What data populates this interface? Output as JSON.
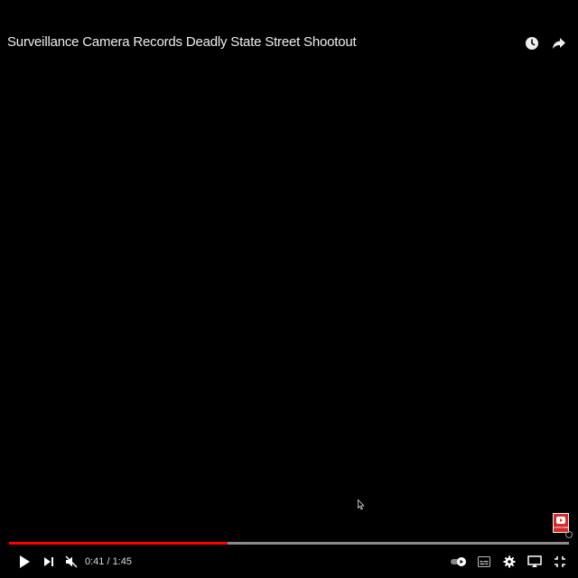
{
  "video": {
    "title": "Surveillance Camera Records Deadly State Street Shootout",
    "current_time": "0:41",
    "duration": "1:45",
    "time_display": "0:41 / 1:45",
    "progress_fraction": 0.39
  },
  "colors": {
    "background": "#000000",
    "progress_played": "#ff0000",
    "progress_track": "#bbbbbb",
    "watermark": "#d52b2b"
  },
  "icons": {
    "top": [
      "clock-icon",
      "share-icon"
    ],
    "left": [
      "play-icon",
      "next-icon",
      "mute-icon"
    ],
    "right": [
      "autoplay-toggle-icon",
      "subtitles-icon",
      "settings-icon",
      "cast-icon",
      "exit-fullscreen-icon"
    ]
  }
}
